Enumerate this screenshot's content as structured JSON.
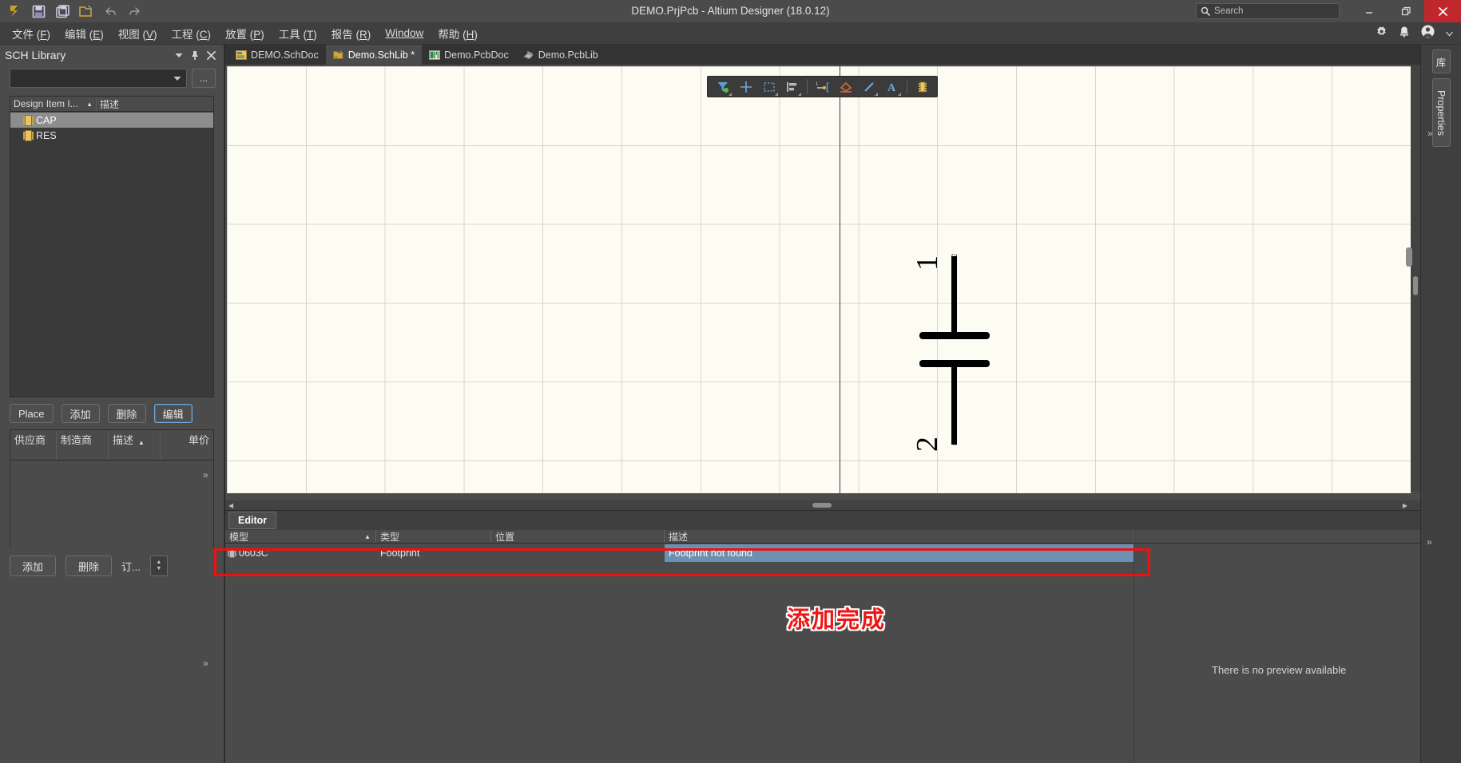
{
  "titlebar": {
    "title": "DEMO.PrjPcb - Altium Designer (18.0.12)",
    "icons": [
      "altium-logo-icon",
      "save-icon",
      "save-all-icon",
      "open-folder-icon",
      "undo-icon",
      "redo-icon"
    ],
    "search_placeholder": "Search",
    "minimize_label": "–",
    "restore_label": "❐",
    "close_label": "✕"
  },
  "menubar": {
    "items": [
      {
        "label": "文件",
        "key": "F"
      },
      {
        "label": "编辑",
        "key": "E"
      },
      {
        "label": "视图",
        "key": "V"
      },
      {
        "label": "工程",
        "key": "C"
      },
      {
        "label": "放置",
        "key": "P"
      },
      {
        "label": "工具",
        "key": "T"
      },
      {
        "label": "报告",
        "key": "R"
      },
      {
        "label": "Window",
        "key": "W"
      },
      {
        "label": "帮助",
        "key": "H"
      }
    ],
    "right_icons": [
      "gear-icon",
      "bell-icon",
      "user-avatar-icon",
      "chevron-down-icon"
    ]
  },
  "sidebar": {
    "panel_title": "SCH Library",
    "header_icons": [
      "chevron-down-icon",
      "pin-icon",
      "close-icon"
    ],
    "library_select_value": "",
    "browse_button_label": "...",
    "tree_columns": [
      "Design Item I...",
      "描述"
    ],
    "tree_items": [
      {
        "name": "CAP",
        "selected": true
      },
      {
        "name": "RES",
        "selected": false
      }
    ],
    "component_buttons": [
      {
        "label": "Place",
        "focused": false
      },
      {
        "label": "添加",
        "focused": false
      },
      {
        "label": "删除",
        "focused": false
      },
      {
        "label": "编辑",
        "focused": true
      }
    ],
    "supplier_columns": [
      "供应商",
      "制造商",
      "描述",
      "单价"
    ],
    "supplier_rows": [],
    "supplier_buttons": [
      {
        "label": "添加"
      },
      {
        "label": "删除"
      },
      {
        "label": "订..."
      }
    ]
  },
  "tabs": [
    {
      "label": "DEMO.SchDoc",
      "icon": "schematic-doc-icon",
      "active": false,
      "modified": false
    },
    {
      "label": "Demo.SchLib *",
      "icon": "schematic-lib-icon",
      "active": true,
      "modified": true
    },
    {
      "label": "Demo.PcbDoc",
      "icon": "pcb-doc-icon",
      "active": false,
      "modified": false
    },
    {
      "label": "Demo.PcbLib",
      "icon": "pcb-lib-icon",
      "active": false,
      "modified": false
    }
  ],
  "canvas": {
    "floating_toolbar_icons": [
      "select-filter-icon",
      "crosshair-icon",
      "area-select-icon",
      "align-icon",
      "place-pin-icon",
      "place-polygon-icon",
      "place-line-icon",
      "place-text-icon",
      "place-component-icon"
    ],
    "symbol": {
      "type": "capacitor",
      "pin1_label": "1",
      "pin2_label": "2"
    }
  },
  "editor": {
    "tab_label": "Editor",
    "model_columns": [
      "模型",
      "类型",
      "位置",
      "描述"
    ],
    "model_rows": [
      {
        "name": "0603C",
        "type": "Footprint",
        "location": "",
        "description": "Footprint not found",
        "selected": true,
        "highlighted": true
      }
    ],
    "preview_message": "There is no preview available"
  },
  "annotation": {
    "text": "添加完成",
    "color": "#f01414"
  },
  "right_rail": {
    "tabs": [
      {
        "label": "库",
        "orientation": "horizontal"
      },
      {
        "label": "Properties",
        "orientation": "vertical"
      }
    ]
  },
  "colors": {
    "window_bg": "#4b4b4b",
    "titlebar_bg": "#4b4b4b",
    "sheet_bg": "#fdfcf3",
    "selection_blue": "#6e90b0",
    "close_red": "#c0272d",
    "annotation_red": "#f01414"
  }
}
